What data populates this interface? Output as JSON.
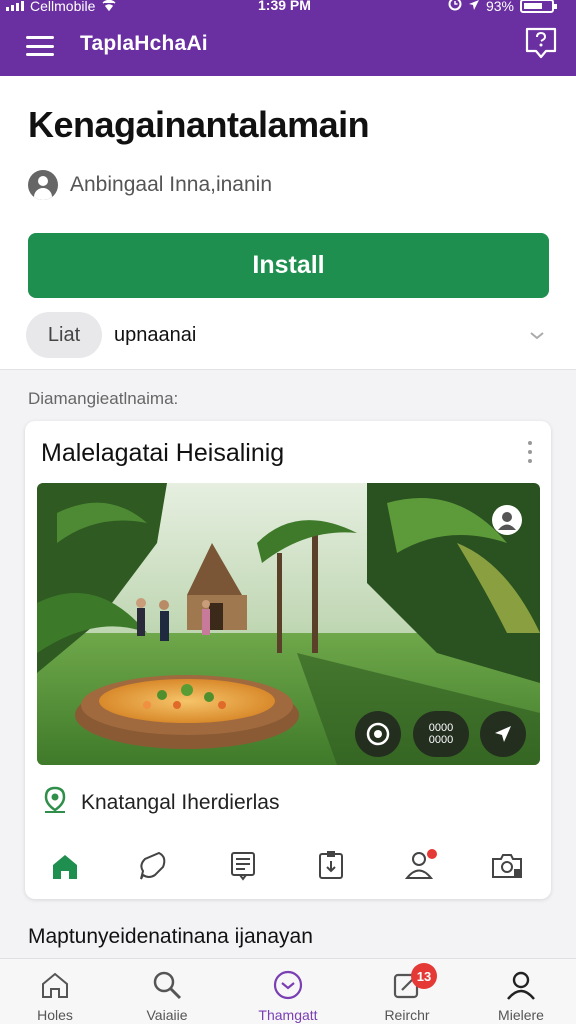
{
  "status_bar": {
    "carrier": "Cellmobile",
    "time": "1:39 PM",
    "battery": "93%",
    "battery_level": 0.93
  },
  "app_bar": {
    "title": "TaplaHchaAi",
    "menu_icon": "hamburger-icon",
    "help_icon": "chat-help-icon"
  },
  "app_header": {
    "title": "Kenagainantalamain",
    "developer": "Anbingaal Inna,inanin",
    "install_label": "Install",
    "tag_chip": "Liat",
    "tag_text": "upnaanai"
  },
  "section_label": "Diamangieatlnaima:",
  "card": {
    "title": "Malelagatai Heisalinig",
    "media_count_line1": "0000",
    "media_count_line2": "0000",
    "location": "Knatangal Iherdierlas",
    "actions": [
      "home-icon",
      "chat-bubble-icon",
      "document-icon",
      "clipboard-icon",
      "person-alert-icon",
      "camera-lock-icon"
    ]
  },
  "promo_text": "Maptunyeidenatinana ijanayan",
  "bottom_nav": {
    "items": [
      {
        "label": "Holes",
        "icon": "home-icon"
      },
      {
        "label": "Vaiaiie",
        "icon": "search-icon"
      },
      {
        "label": "Thamgatt",
        "icon": "chevron-circle-icon"
      },
      {
        "label": "Reirchr",
        "icon": "edit-square-icon",
        "badge": "13"
      },
      {
        "label": "Mielere",
        "icon": "person-icon"
      }
    ],
    "active_index": 2
  },
  "colors": {
    "brand_purple": "#6a2fa0",
    "install_green": "#1e8f4e",
    "badge_red": "#e53935"
  }
}
